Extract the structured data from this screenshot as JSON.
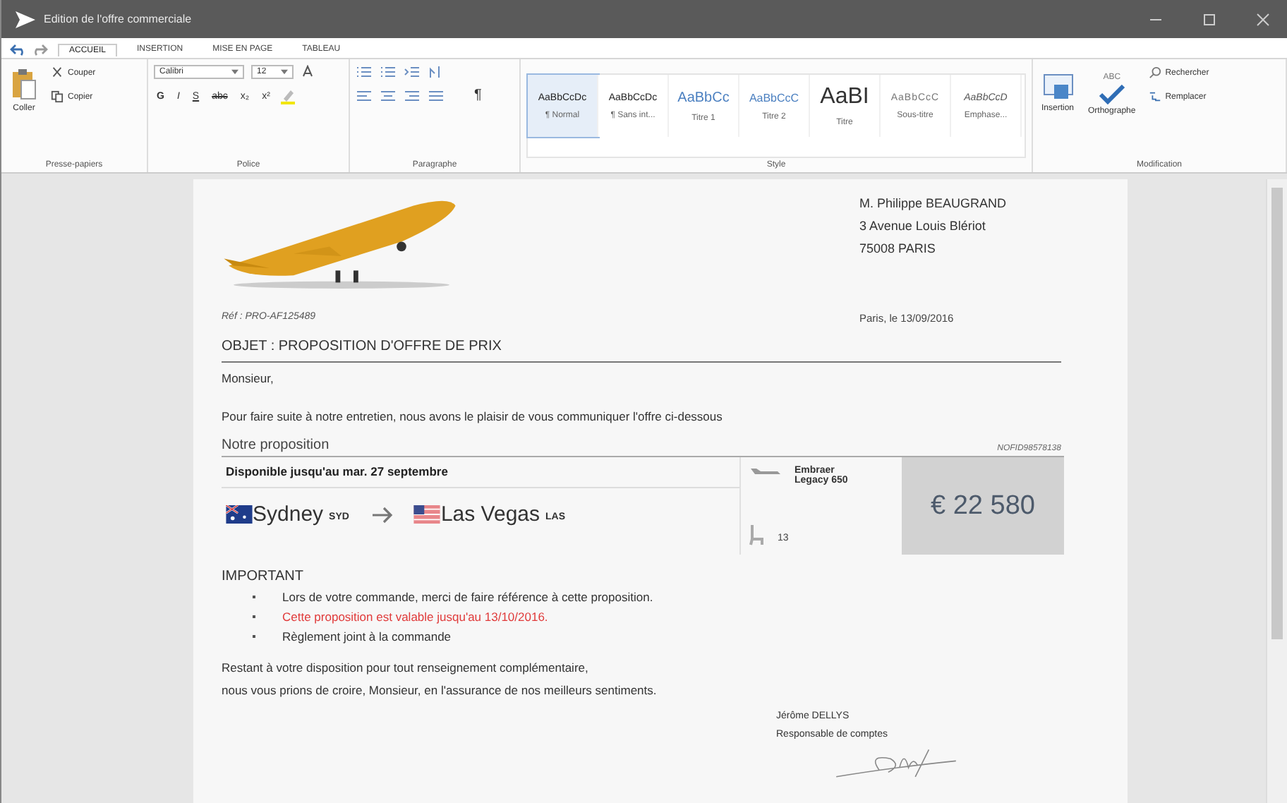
{
  "window": {
    "title": "Edition de l'offre commerciale"
  },
  "tabs": [
    {
      "label": "ACCUEIL",
      "selected": true
    },
    {
      "label": "INSERTION",
      "selected": false
    },
    {
      "label": "MISE EN PAGE",
      "selected": false
    },
    {
      "label": "TABLEAU",
      "selected": false
    }
  ],
  "ribbon": {
    "clipboard": {
      "label": "Presse-papiers",
      "paste": "Coller",
      "cut": "Couper",
      "copy": "Copier"
    },
    "font": {
      "label": "Police",
      "family": "Calibri",
      "size": "12",
      "format_buttons": [
        "G",
        "I",
        "S",
        "abc",
        "x₂",
        "x²"
      ]
    },
    "paragraph": {
      "label": "Paragraphe",
      "pilcrow": "¶"
    },
    "styles": {
      "label": "Style",
      "items": [
        {
          "preview": "AaBbCcDc",
          "name": "¶ Normal",
          "kind": "plain",
          "selected": true
        },
        {
          "preview": "AaBbCcDc",
          "name": "¶ Sans int...",
          "kind": "plain",
          "selected": false
        },
        {
          "preview": "AaBbCc",
          "name": "Titre 1",
          "kind": "heading1",
          "selected": false
        },
        {
          "preview": "AaBbCcC",
          "name": "Titre 2",
          "kind": "heading2",
          "selected": false
        },
        {
          "preview": "AaBI",
          "name": "Titre",
          "kind": "title",
          "selected": false
        },
        {
          "preview": "AaBbCcC",
          "name": "Sous-titre",
          "kind": "subtitle",
          "selected": false
        },
        {
          "preview": "AaBbCcD",
          "name": "Emphase...",
          "kind": "emphasis",
          "selected": false
        }
      ]
    },
    "editing": {
      "label": "Modification",
      "insert": "Insertion",
      "spelling": "Orthographe",
      "spelling_badge": "ABC",
      "find": "Rechercher",
      "replace": "Remplacer"
    }
  },
  "document": {
    "recipient": [
      "M. Philippe BEAUGRAND",
      "3 Avenue Louis Blériot",
      "75008 PARIS"
    ],
    "reference": "Réf : PRO-AF125489",
    "date": "Paris, le 13/09/2016",
    "subject": "OBJET : PROPOSITION D'OFFRE DE PRIX",
    "greeting": "Monsieur,",
    "intro": "Pour faire suite à notre entretien, nous avons le plaisir de vous communiquer l'offre ci-dessous",
    "proposal_title": "Notre proposition",
    "proposal_code": "NOFID98578138",
    "offer": {
      "availability": "Disponible jusqu'au mar. 27 septembre",
      "origin_city": "Sydney",
      "origin_code": "SYD",
      "destination_city": "Las Vegas",
      "destination_code": "LAS",
      "aircraft": [
        "Embraer",
        "Legacy 650"
      ],
      "seats": "13",
      "price": "€ 22 580"
    },
    "important_title": "IMPORTANT",
    "important_items": [
      {
        "text": "Lors de votre commande, merci de faire référence à cette proposition.",
        "kind": "normal"
      },
      {
        "text": "Cette proposition est valable jusqu'au 13/10/2016.",
        "kind": "warning"
      },
      {
        "text": "Règlement joint à la commande",
        "kind": "normal"
      }
    ],
    "closing": [
      "Restant à votre disposition pour tout renseignement complémentaire,",
      "nous vous prions de croire, Monsieur, en l'assurance de nos meilleurs sentiments."
    ],
    "signer_name": "Jérôme DELLYS",
    "signer_role": "Responsable de comptes"
  }
}
